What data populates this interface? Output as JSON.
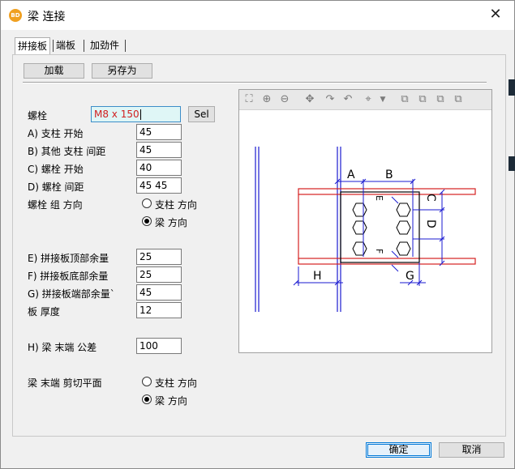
{
  "window": {
    "title": "梁 连接",
    "icon_text": "BD"
  },
  "tabs": [
    "拼接板",
    "端板",
    "加劲件"
  ],
  "toolbar": {
    "load_label": "加载",
    "save_as_label": "另存为"
  },
  "form": {
    "bolt_label": "螺栓",
    "bolt_value": "M8 x 150",
    "sel_label": "Sel",
    "a_label": "A) 支柱 开始",
    "a_value": "45",
    "b_label": "B) 其他 支柱 间距",
    "b_value": "45",
    "c_label": "C) 螺栓 开始",
    "c_value": "40",
    "d_label": "D) 螺栓 间距",
    "d_value": "45 45",
    "group_dir_label": "螺栓 组 方向",
    "group_dir_opt1": "支柱 方向",
    "group_dir_opt2": "梁 方向",
    "e_label": "E) 拼接板顶部余量",
    "e_value": "25",
    "f_label": "F) 拼接板底部余量",
    "f_value": "25",
    "g_label": "G) 拼接板端部余量`",
    "g_value": "45",
    "thk_label": "板 厚度",
    "thk_value": "12",
    "h_label": "H) 梁 末端 公差",
    "h_value": "100",
    "cut_label": "梁 末端 剪切平面",
    "cut_opt1": "支柱 方向",
    "cut_opt2": "梁 方向"
  },
  "preview": {
    "toolbar_icons": [
      "zoom-extents-icon",
      "zoom-in-icon",
      "zoom-out-icon",
      "pan-icon",
      "rotate-right-icon",
      "rotate-left-icon",
      "view-options-icon",
      "view-front-icon",
      "view-side-icon",
      "view-top-icon",
      "view-iso-icon"
    ],
    "labels": {
      "A": "A",
      "B": "B",
      "C": "C",
      "D": "D",
      "E": "E",
      "F": "F",
      "G": "G",
      "H": "H"
    }
  },
  "footer": {
    "ok_label": "确定",
    "cancel_label": "取消"
  },
  "colors": {
    "beam": "#d42020",
    "dim": "#1a1ad0",
    "plate": "#000000"
  }
}
